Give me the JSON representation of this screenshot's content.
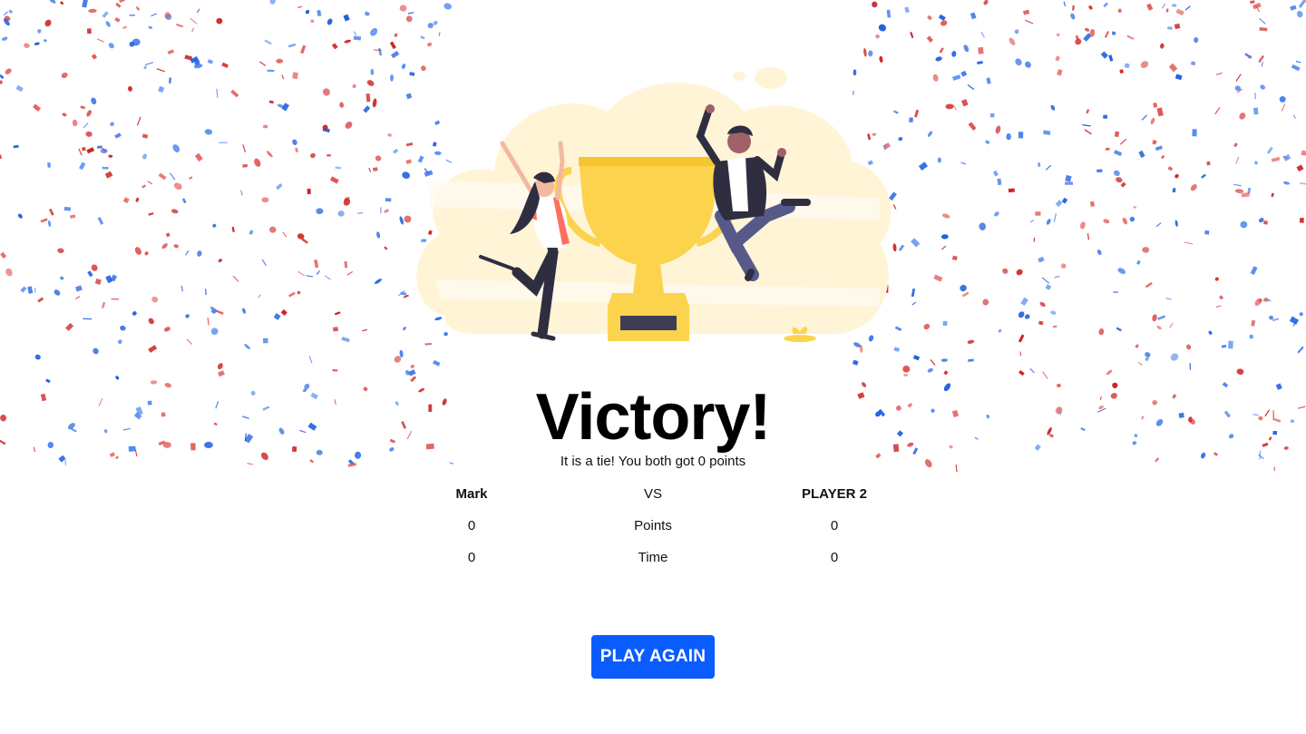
{
  "result": {
    "title": "Victory!",
    "message": "It is a tie! You both got 0 points"
  },
  "scoreboard": {
    "player1": "Mark",
    "vs_label": "VS",
    "player2": "PLAYER 2",
    "rows": [
      {
        "label": "Points",
        "player1": "0",
        "player2": "0"
      },
      {
        "label": "Time",
        "player1": "0",
        "player2": "0"
      }
    ]
  },
  "actions": {
    "play_again_label": "PLAY AGAIN"
  },
  "colors": {
    "accent": "#0b5cff",
    "confetti_red": "#cc1f1f",
    "confetti_blue": "#1f5fe0",
    "trophy_gold": "#fcd34d",
    "cloud_cream": "#fff4d6"
  },
  "illustration": {
    "name": "trophy-celebration-illustration"
  }
}
